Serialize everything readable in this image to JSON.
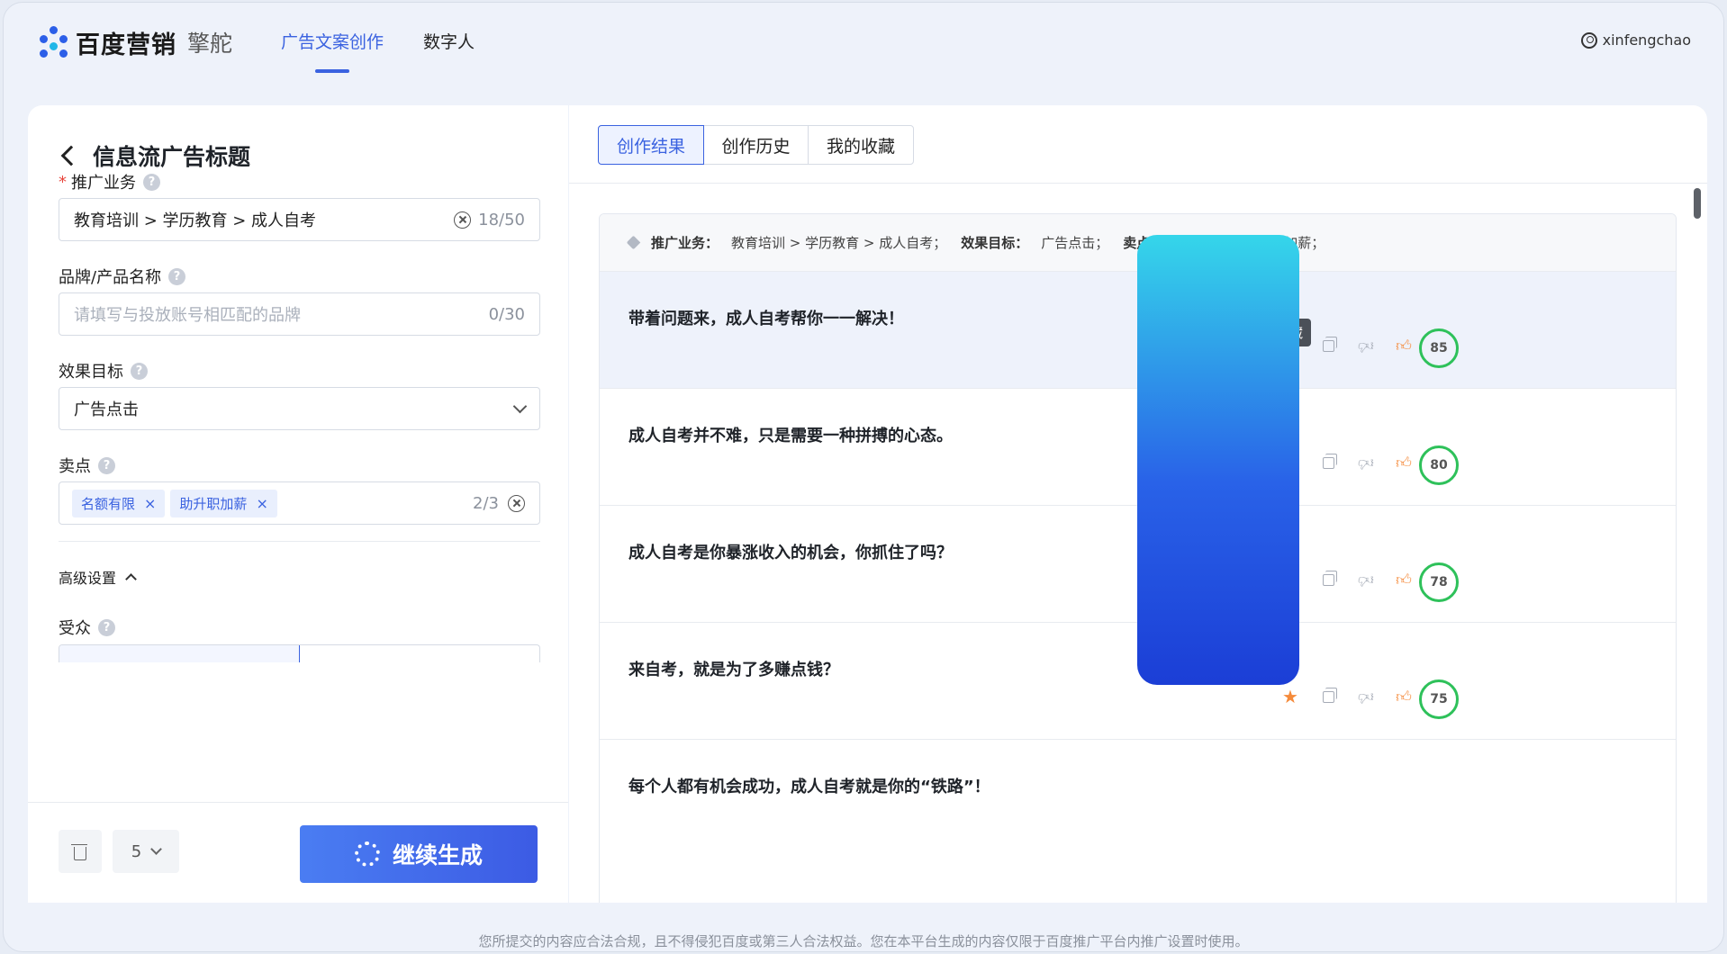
{
  "brand": {
    "name": "百度营销",
    "product": "擎舵"
  },
  "nav": [
    {
      "label": "广告文案创作",
      "active": true
    },
    {
      "label": "数字人",
      "active": false
    }
  ],
  "user": {
    "name": "xinfengchao"
  },
  "form": {
    "title": "信息流广告标题",
    "business": {
      "label": "推广业务",
      "value": "教育培训 > 学历教育 > 成人自考",
      "count": "18/50"
    },
    "brand": {
      "label": "品牌/产品名称",
      "placeholder": "请填写与投放账号相匹配的品牌",
      "count": "0/30"
    },
    "goal": {
      "label": "效果目标",
      "value": "广告点击"
    },
    "selling": {
      "label": "卖点",
      "tags": [
        "名额有限",
        "助升职加薪"
      ],
      "count": "2/3"
    },
    "advanced_label": "高级设置",
    "audience_label": "受众",
    "count_value": "5",
    "generate_label": "继续生成"
  },
  "tabs": [
    {
      "label": "创作结果",
      "active": true
    },
    {
      "label": "创作历史",
      "active": false
    },
    {
      "label": "我的收藏",
      "active": false
    }
  ],
  "summary": {
    "business_label": "推广业务：",
    "business_value": "教育培训 > 学历教育 > 成人自考；",
    "goal_label": "效果目标：",
    "goal_value": "广告点击；",
    "selling_label": "卖点：",
    "selling_value": "名额有限、助升职加薪；"
  },
  "results": [
    {
      "text": "带着问题来，成人自考帮你一一解决！",
      "score": "85",
      "favorited": false
    },
    {
      "text": "成人自考并不难，只是需要一种拼搏的心态。",
      "score": "80",
      "favorited": true
    },
    {
      "text": "成人自考是你暴涨收入的机会，你抓住了吗？",
      "score": "78",
      "favorited": true
    },
    {
      "text": "来自考，就是为了多赚点钱？",
      "score": "75",
      "favorited": true
    },
    {
      "text": "每个人都有机会成功，成人自考就是你的“铁路”！",
      "score": "",
      "favorited": false
    }
  ],
  "tooltip": "收藏",
  "footer": "您所提交的内容应合法合规，且不得侵犯百度或第三人合法权益。您在本平台生成的内容仅限于百度推广平台内推广设置时使用。",
  "colors": {
    "accent": "#3a62e0",
    "score_ring": "#2ec15a",
    "favorite": "#f58a3a"
  }
}
